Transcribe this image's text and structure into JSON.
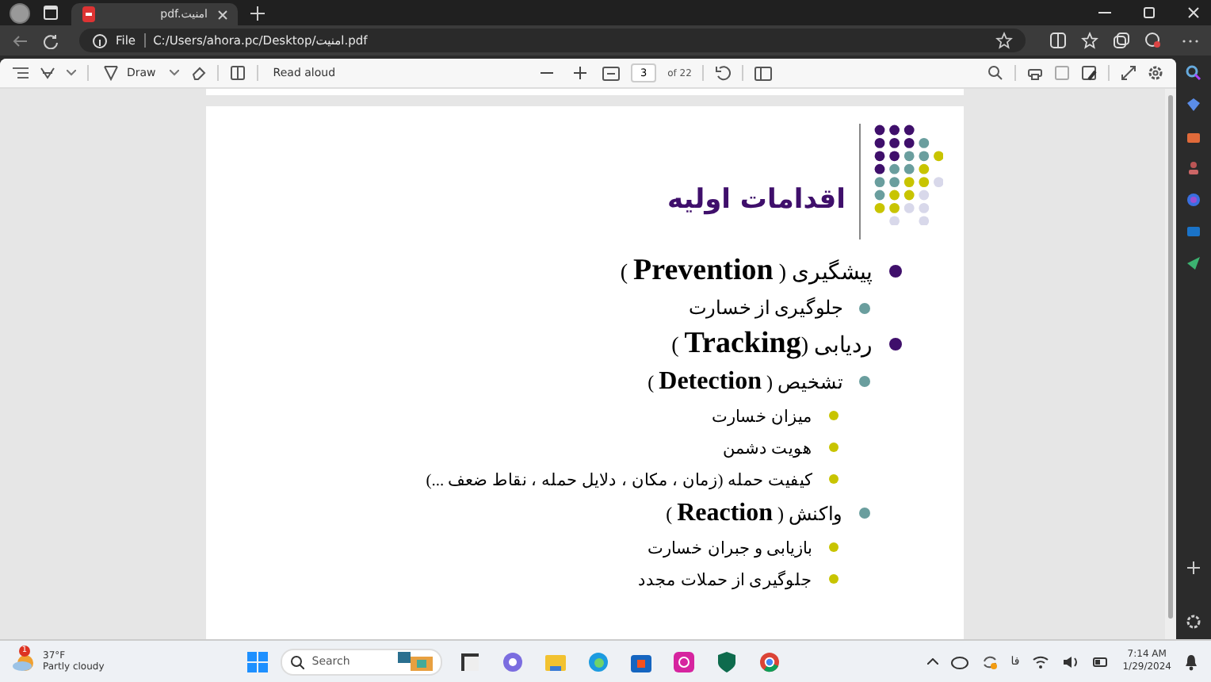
{
  "browser": {
    "tabs": [
      {
        "title": "pdf.امنیت",
        "selected": true
      }
    ],
    "address": {
      "scheme": "File",
      "url": "C:/Users/ahora.pc/Desktop/امنیت.pdf"
    }
  },
  "pdf_toolbar": {
    "draw_label": "Draw",
    "read_aloud": "Read aloud",
    "page": "3",
    "page_total": "of 22"
  },
  "slide": {
    "title": "اقدامات اولیه",
    "bullets": [
      {
        "text": "پیشگیری ( **Prevention** )",
        "color": "#3f0f6b",
        "children": [
          {
            "text": "جلوگیری از خسارت",
            "color": "#6a9e9e"
          }
        ]
      },
      {
        "text": "ردیابی (**Tracking** )",
        "color": "#3f0f6b",
        "children": [
          {
            "text": "تشخیص ( **Detection** )",
            "color": "#6a9e9e",
            "children": [
              {
                "text": "میزان خسارت",
                "color": "#c8c400"
              },
              {
                "text": "هویت دشمن",
                "color": "#c8c400"
              },
              {
                "text": "کیفیت حمله (زمان ، مکان ، دلایل حمله ، نقاط ضعف ...)",
                "color": "#c8c400"
              }
            ]
          },
          {
            "text": "واکنش ( **Reaction** )",
            "color": "#6a9e9e",
            "children": [
              {
                "text": "بازیابی و جبران خسارت",
                "color": "#c8c400"
              },
              {
                "text": "جلوگیری از حملات مجدد",
                "color": "#c8c400"
              }
            ]
          }
        ]
      }
    ]
  },
  "taskbar": {
    "weather": {
      "temp": "37°F",
      "condition": "Partly cloudy",
      "badge": "1"
    },
    "search_placeholder": "Search",
    "language": "فا",
    "time": "7:14 AM",
    "date": "1/29/2024"
  }
}
